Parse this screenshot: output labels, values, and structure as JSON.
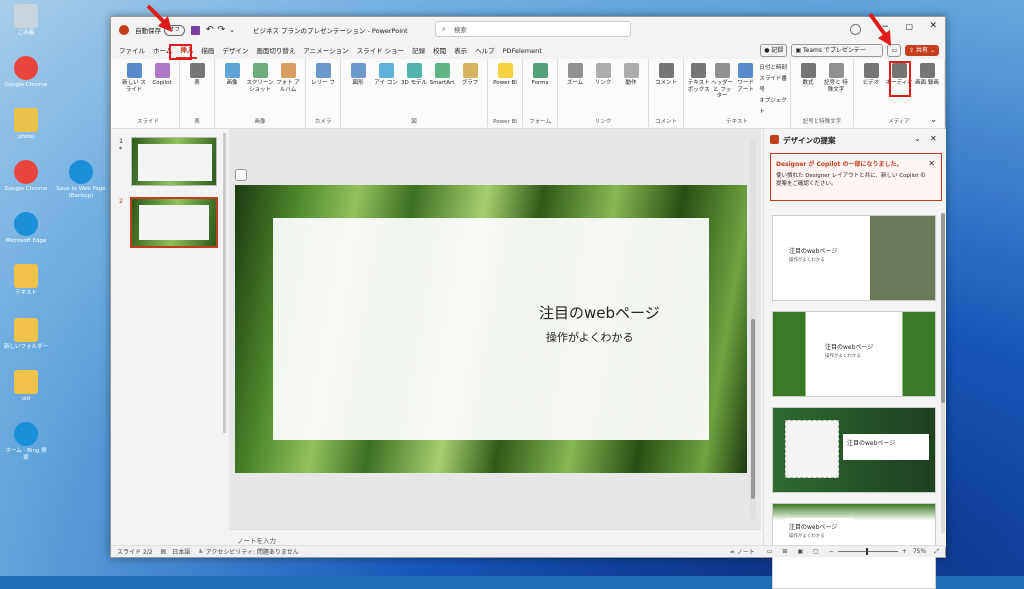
{
  "desktop": {
    "icons": [
      {
        "label": "ごみ箱",
        "color": "#c9d4de"
      },
      {
        "label": "Google Chrome",
        "color": "#e8453c"
      },
      {
        "label": "photo",
        "color": "#e9c14b"
      },
      {
        "label": "Google Chrome",
        "color": "#e8453c"
      },
      {
        "label": "Microsoft Edge",
        "color": "#1b8fd8"
      },
      {
        "label": "テキスト",
        "color": "#f0c24a"
      },
      {
        "label": "新しいフォルダー",
        "color": "#f0c24a"
      },
      {
        "label": "old",
        "color": "#f0c24a"
      },
      {
        "label": "ホーム - Bing 検索",
        "color": "#1b8fd8"
      }
    ],
    "edge_capture": "Save to Web Page (Backup)"
  },
  "window": {
    "autosave": "自動保存",
    "autosave_state": "オフ",
    "filename": "ビジネス プランのプレゼンテーション",
    "app": "PowerPoint",
    "title_sep": " - ",
    "search_placeholder": "検索"
  },
  "menu": [
    "ファイル",
    "ホーム",
    "挿入",
    "描画",
    "デザイン",
    "画面切り替え",
    "アニメーション",
    "スライド ショー",
    "記録",
    "校閲",
    "表示",
    "ヘルプ",
    "PDFelement"
  ],
  "menu_right": {
    "record": "記録",
    "teams": "Teams でプレゼンテー",
    "share": "共有"
  },
  "ribbon": {
    "slides": {
      "label": "スライド",
      "btns": [
        "新しい スライド",
        "Copilot"
      ]
    },
    "table": {
      "label": "表",
      "btns": [
        "表"
      ]
    },
    "images": {
      "label": "画像",
      "btns": [
        "画像",
        "スクリーン ショット",
        "フォト アルバム"
      ]
    },
    "camera": {
      "label": "カメラ",
      "btns": [
        "レリー フ"
      ]
    },
    "shapes": {
      "label": "図",
      "btns": [
        "図形",
        "アイ コン",
        "3D モデル",
        "SmartArt",
        "グラフ"
      ]
    },
    "powerbi": {
      "label": "Power BI",
      "btns": [
        "Power BI"
      ]
    },
    "forms": {
      "label": "フォーム",
      "btns": [
        "Forms"
      ]
    },
    "links": {
      "label": "リンク",
      "btns": [
        "ズーム",
        "リンク",
        "動作"
      ]
    },
    "comments": {
      "label": "コメント",
      "btns": [
        "コメント"
      ]
    },
    "text": {
      "label": "テキスト",
      "btns": [
        "テキスト ボックス",
        "ヘッダーと フッター",
        "ワード アート"
      ],
      "small": [
        "日付と時刻",
        "スライド番号",
        "オブジェクト"
      ]
    },
    "symbols": {
      "label": "記号と特殊文字",
      "btns": [
        "数式",
        "記号と 特殊文字"
      ]
    },
    "media": {
      "label": "メディア",
      "btns": [
        "ビデオ",
        "オーディオ",
        "画面 録画"
      ]
    }
  },
  "thumbnails": [
    {
      "num": "1",
      "star": "*"
    },
    {
      "num": "2",
      "star": ""
    }
  ],
  "slide": {
    "title": "注目のwebページ",
    "subtitle": "操作がよくわかる"
  },
  "notes_placeholder": "ノートを入力",
  "designer": {
    "header": "デザインの提案",
    "notice_title": "Designer が Copilot の一部になりました。",
    "notice_body": "使い慣れた Designer レイアウトと共に、新しい Copilot の提案をご確認ください。",
    "cards": [
      {
        "title": "注目のwebページ",
        "sub": "操作がよくわかる"
      },
      {
        "title": "注目のwebページ",
        "sub": "操作がよくわかる"
      },
      {
        "title": "注目のwebページ",
        "sub": ""
      },
      {
        "title": "注目のwebページ",
        "sub": "操作がよくわかる"
      }
    ]
  },
  "status": {
    "slide": "スライド 2/2",
    "lang": "日本語",
    "access": "アクセシビリティ: 問題ありません",
    "notes": "ノート",
    "zoom": "75%"
  },
  "colors": {
    "accent": "#c43e1c",
    "highlight": "#e01b1b"
  }
}
